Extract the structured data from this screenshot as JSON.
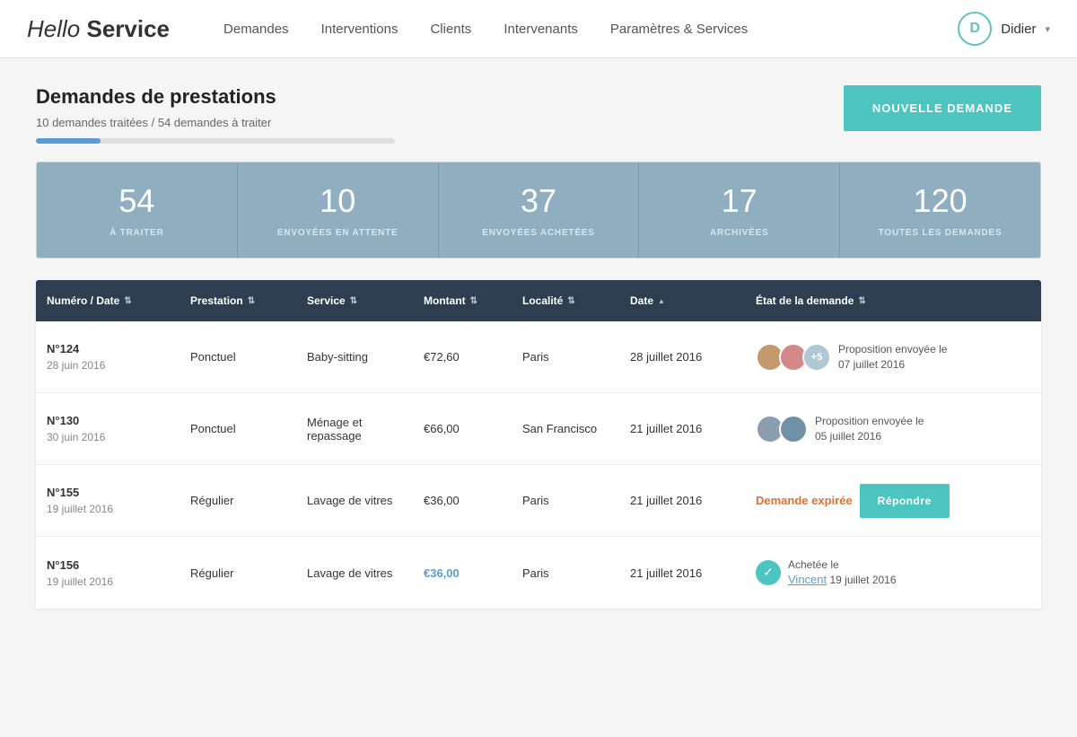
{
  "nav": {
    "logo_hello": "Hello ",
    "logo_service": "Service",
    "links": [
      {
        "label": "Demandes",
        "key": "demandes"
      },
      {
        "label": "Interventions",
        "key": "interventions"
      },
      {
        "label": "Clients",
        "key": "clients"
      },
      {
        "label": "Intervenants",
        "key": "intervenants"
      },
      {
        "label": "Paramètres & Services",
        "key": "parametres"
      }
    ],
    "user_initial": "D",
    "user_name": "Didier"
  },
  "page": {
    "title": "Demandes de prestations",
    "subtitle": "10 demandes traitées / 54 demandes à traiter",
    "progress_percent": 18,
    "btn_new": "NOUVELLE DEMANDE"
  },
  "stats": [
    {
      "number": "54",
      "label": "À TRAITER"
    },
    {
      "number": "10",
      "label": "ENVOYÉES EN ATTENTE"
    },
    {
      "number": "37",
      "label": "ENVOYÉES ACHETÉES"
    },
    {
      "number": "17",
      "label": "ARCHIVÉES"
    },
    {
      "number": "120",
      "label": "TOUTES LES DEMANDES"
    }
  ],
  "table": {
    "columns": [
      {
        "label": "Numéro / Date",
        "sort": "both"
      },
      {
        "label": "Prestation",
        "sort": "both"
      },
      {
        "label": "Service",
        "sort": "both"
      },
      {
        "label": "Montant",
        "sort": "both"
      },
      {
        "label": "Localité",
        "sort": "both"
      },
      {
        "label": "Date",
        "sort": "up"
      },
      {
        "label": "État de la demande",
        "sort": "both"
      }
    ],
    "rows": [
      {
        "num": "N°124",
        "date": "28 juin 2016",
        "prestation": "Ponctuel",
        "service": "Baby-sitting",
        "montant": "€72,60",
        "montant_highlight": false,
        "localite": "Paris",
        "date_col": "28 juillet 2016",
        "avatars": [
          "av1",
          "av2"
        ],
        "avatar_plus": "+5",
        "etat_type": "proposition",
        "etat_text": "Proposition envoyée le",
        "etat_date": "07 juillet 2016",
        "btn": null,
        "check": false,
        "link_name": null
      },
      {
        "num": "N°130",
        "date": "30 juin 2016",
        "prestation": "Ponctuel",
        "service": "Ménage et repassage",
        "montant": "€66,00",
        "montant_highlight": false,
        "localite": "San Francisco",
        "date_col": "21 juillet 2016",
        "avatars": [
          "av3",
          "av4"
        ],
        "avatar_plus": null,
        "etat_type": "proposition",
        "etat_text": "Proposition envoyée le",
        "etat_date": "05 juillet 2016",
        "btn": null,
        "check": false,
        "link_name": null
      },
      {
        "num": "N°155",
        "date": "19 juillet 2016",
        "prestation": "Régulier",
        "service": "Lavage de vitres",
        "montant": "€36,00",
        "montant_highlight": false,
        "localite": "Paris",
        "date_col": "21 juillet 2016",
        "avatars": [],
        "avatar_plus": null,
        "etat_type": "expired",
        "etat_text": "Demande expirée",
        "etat_date": null,
        "btn": "Répondre",
        "check": false,
        "link_name": null
      },
      {
        "num": "N°156",
        "date": "19 juillet 2016",
        "prestation": "Régulier",
        "service": "Lavage de vitres",
        "montant": "€36,00",
        "montant_highlight": true,
        "localite": "Paris",
        "date_col": "21 juillet 2016",
        "avatars": [],
        "avatar_plus": null,
        "etat_type": "achetee",
        "etat_text": "Achetée le",
        "etat_date": "19 juillet 2016",
        "btn": null,
        "check": true,
        "link_name": "Vincent"
      }
    ]
  }
}
